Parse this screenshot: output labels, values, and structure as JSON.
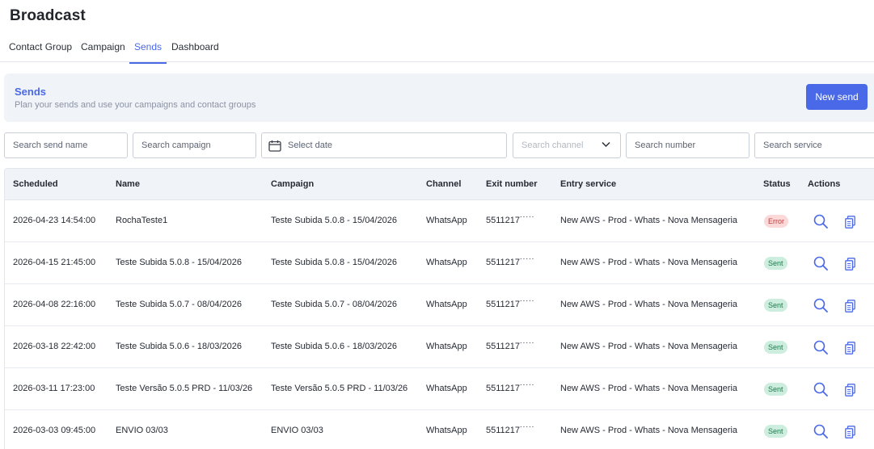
{
  "app": {
    "title": "Broadcast"
  },
  "tabs": [
    {
      "label": "Contact Group",
      "active": false
    },
    {
      "label": "Campaign",
      "active": false
    },
    {
      "label": "Sends",
      "active": true
    },
    {
      "label": "Dashboard",
      "active": false
    }
  ],
  "banner": {
    "title": "Sends",
    "subtitle": "Plan your sends and use your campaigns and contact groups",
    "new_button": "New send"
  },
  "filters": {
    "send_name_placeholder": "Search send name",
    "campaign_placeholder": "Search campaign",
    "date_placeholder": "Select date",
    "channel_placeholder": "Search channel",
    "number_placeholder": "Search number",
    "service_placeholder": "Search service"
  },
  "table": {
    "columns": [
      "Scheduled",
      "Name",
      "Campaign",
      "Channel",
      "Exit number",
      "Entry service",
      "Status",
      "Actions"
    ],
    "rows": [
      {
        "scheduled": "2026-04-23 14:54:00",
        "name": "RochaTeste1",
        "campaign": "Teste Subida 5.0.8 - 15/04/2026",
        "channel": "WhatsApp",
        "exit_number": "5511217˙˙˙˙˙",
        "entry_service": "New AWS - Prod - Whats - Nova Mensageria",
        "status": "Error",
        "status_type": "error"
      },
      {
        "scheduled": "2026-04-15 21:45:00",
        "name": "Teste Subida 5.0.8 - 15/04/2026",
        "campaign": "Teste Subida 5.0.8 - 15/04/2026",
        "channel": "WhatsApp",
        "exit_number": "5511217˙˙˙˙˙",
        "entry_service": "New AWS - Prod - Whats - Nova Mensageria",
        "status": "Sent",
        "status_type": "sent"
      },
      {
        "scheduled": "2026-04-08 22:16:00",
        "name": "Teste Subida 5.0.7 - 08/04/2026",
        "campaign": "Teste Subida 5.0.7 - 08/04/2026",
        "channel": "WhatsApp",
        "exit_number": "5511217˙˙˙˙˙",
        "entry_service": "New AWS - Prod - Whats - Nova Mensageria",
        "status": "Sent",
        "status_type": "sent"
      },
      {
        "scheduled": "2026-03-18 22:42:00",
        "name": "Teste Subida 5.0.6 - 18/03/2026",
        "campaign": "Teste Subida 5.0.6 - 18/03/2026",
        "channel": "WhatsApp",
        "exit_number": "5511217˙˙˙˙˙",
        "entry_service": "New AWS - Prod - Whats - Nova Mensageria",
        "status": "Sent",
        "status_type": "sent"
      },
      {
        "scheduled": "2026-03-11 17:23:00",
        "name": "Teste Versão 5.0.5 PRD - 11/03/26",
        "campaign": "Teste Versão 5.0.5 PRD - 11/03/26",
        "channel": "WhatsApp",
        "exit_number": "5511217˙˙˙˙˙",
        "entry_service": "New AWS - Prod - Whats - Nova Mensageria",
        "status": "Sent",
        "status_type": "sent"
      },
      {
        "scheduled": "2026-03-03 09:45:00",
        "name": "ENVIO 03/03",
        "campaign": "ENVIO 03/03",
        "channel": "WhatsApp",
        "exit_number": "5511217˙˙˙˙˙",
        "entry_service": "New AWS - Prod - Whats - Nova Mensageria",
        "status": "Sent",
        "status_type": "sent"
      }
    ]
  },
  "colors": {
    "accent": "#4a69e8",
    "sent_bg": "#cdeede",
    "error_bg": "#fbd9d9"
  },
  "icons": [
    "calendar-icon",
    "chevron-down-icon",
    "search-icon",
    "copy-icon"
  ]
}
